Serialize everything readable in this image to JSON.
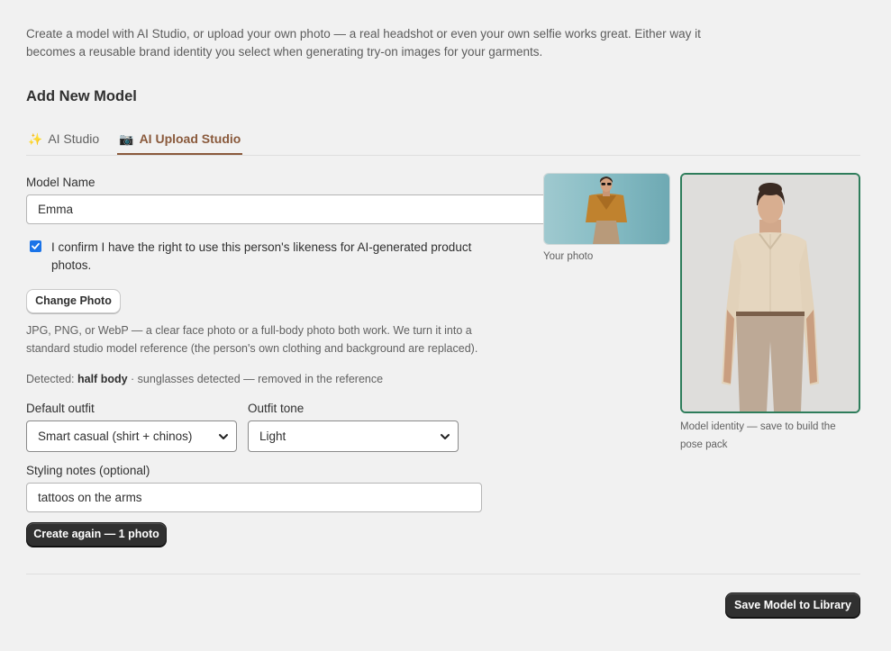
{
  "intro_text": "Create a model with AI Studio, or upload your own photo — a real headshot or even your own selfie works great. Either way it becomes a reusable brand identity you select when generating try-on images for your garments.",
  "section_title": "Add New Model",
  "tabs": [
    {
      "icon": "✨",
      "label": "AI Studio"
    },
    {
      "icon": "📷",
      "label": "AI Upload Studio"
    }
  ],
  "form": {
    "model_name_label": "Model Name",
    "model_name_value": "Emma",
    "consent_text": "I confirm I have the right to use this person's likeness for AI-generated product photos.",
    "consent_checked": true,
    "change_photo_label": "Change Photo",
    "help_text": "JPG, PNG, or WebP — a clear face photo or a full-body photo both work. We turn it into a standard studio model reference (the person's own clothing and background are replaced).",
    "detected_prefix": "Detected:",
    "detected_value": "half body",
    "detected_suffix": "· sunglasses detected — removed in the reference",
    "default_outfit_label": "Default outfit",
    "default_outfit_value": "Smart casual (shirt + chinos)",
    "outfit_tone_label": "Outfit tone",
    "outfit_tone_value": "Light",
    "styling_notes_label": "Styling notes (optional)",
    "styling_notes_value": "tattoos on the arms",
    "create_again_label": "Create again — 1 photo"
  },
  "preview": {
    "your_photo_caption": "Your photo",
    "model_caption": "Model identity — save to build the pose pack"
  },
  "footer": {
    "save_label": "Save Model to Library"
  },
  "colors": {
    "accent_tab": "#8a5a3c",
    "identity_border": "#2e7d5b",
    "dark_button": "#303030"
  }
}
